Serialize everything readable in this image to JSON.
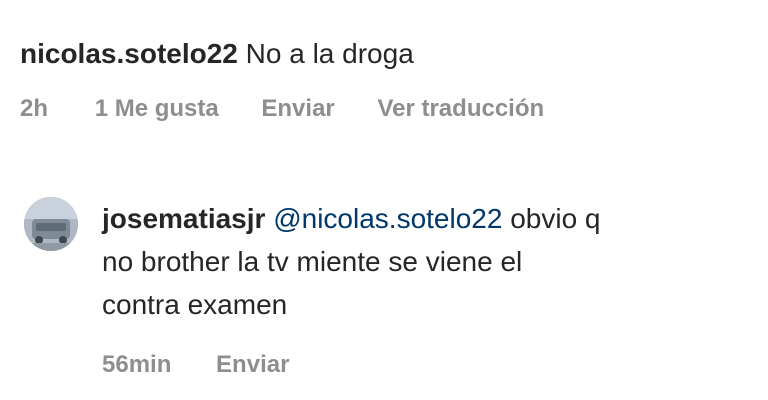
{
  "comment": {
    "username": "nicolas.sotelo22",
    "text": "No a la droga",
    "time": "2h",
    "likes": "1 Me gusta",
    "reply_label": "Enviar",
    "translate_label": "Ver traducción"
  },
  "reply": {
    "avatar_icon": "user-avatar",
    "username": "josematiasjr",
    "mention": "@nicolas.sotelo22",
    "text_line1": "obvio q",
    "text_line2": "no brother la tv miente se viene el",
    "text_line3": "contra examen",
    "time": "56min",
    "reply_label": "Enviar"
  },
  "colors": {
    "text": "#262626",
    "meta": "#8e8e8e",
    "mention": "#00376b"
  }
}
